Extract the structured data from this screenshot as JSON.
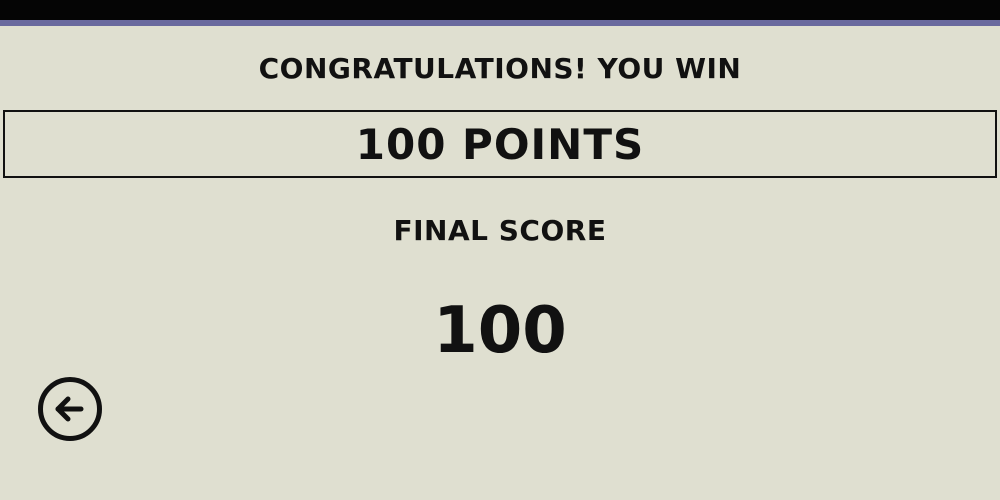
{
  "win_screen": {
    "message": "CONGRATULATIONS! YOU WIN",
    "points_banner": "100 POINTS",
    "final_score_label": "FINAL SCORE",
    "final_score_value": "100"
  },
  "navigation": {
    "back_icon": "arrow-left-circle-icon"
  },
  "colors": {
    "background": "#dfdfd0",
    "top_bar": "#050505",
    "top_accent": "#6a6a9e",
    "text": "#111111"
  }
}
